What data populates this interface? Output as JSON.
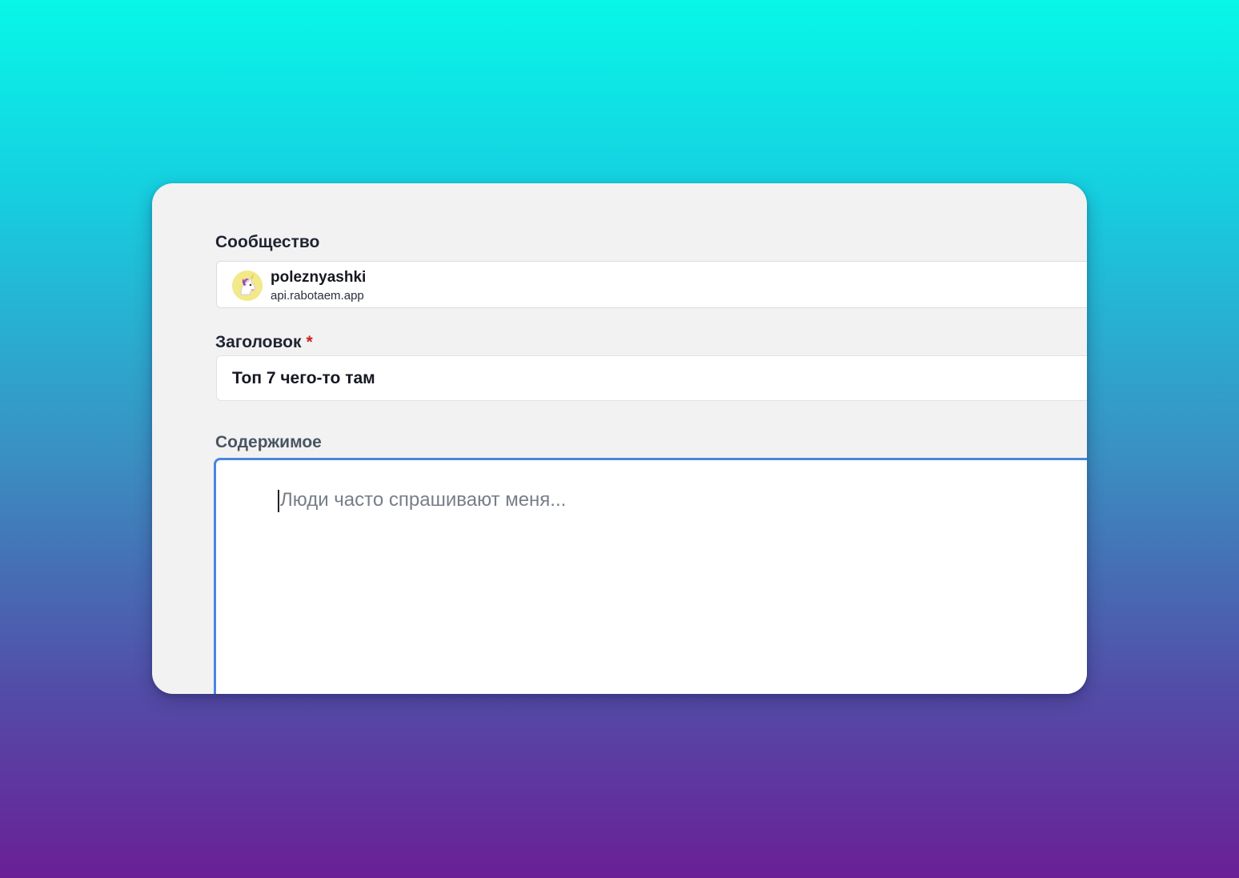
{
  "form": {
    "community": {
      "label": "Сообщество",
      "name": "poleznyashki",
      "domain": "api.rabotaem.app",
      "avatar_icon": "unicorn-icon"
    },
    "title": {
      "label": "Заголовок",
      "required_mark": "*",
      "value": "Топ 7 чего-то там"
    },
    "content": {
      "label": "Содержимое",
      "placeholder": "Люди часто спрашивают меня..."
    }
  },
  "colors": {
    "focus_border": "#4a86dd",
    "required": "#d21c1c",
    "background_top": "#07f7e8",
    "background_bottom": "#6a1f96"
  }
}
